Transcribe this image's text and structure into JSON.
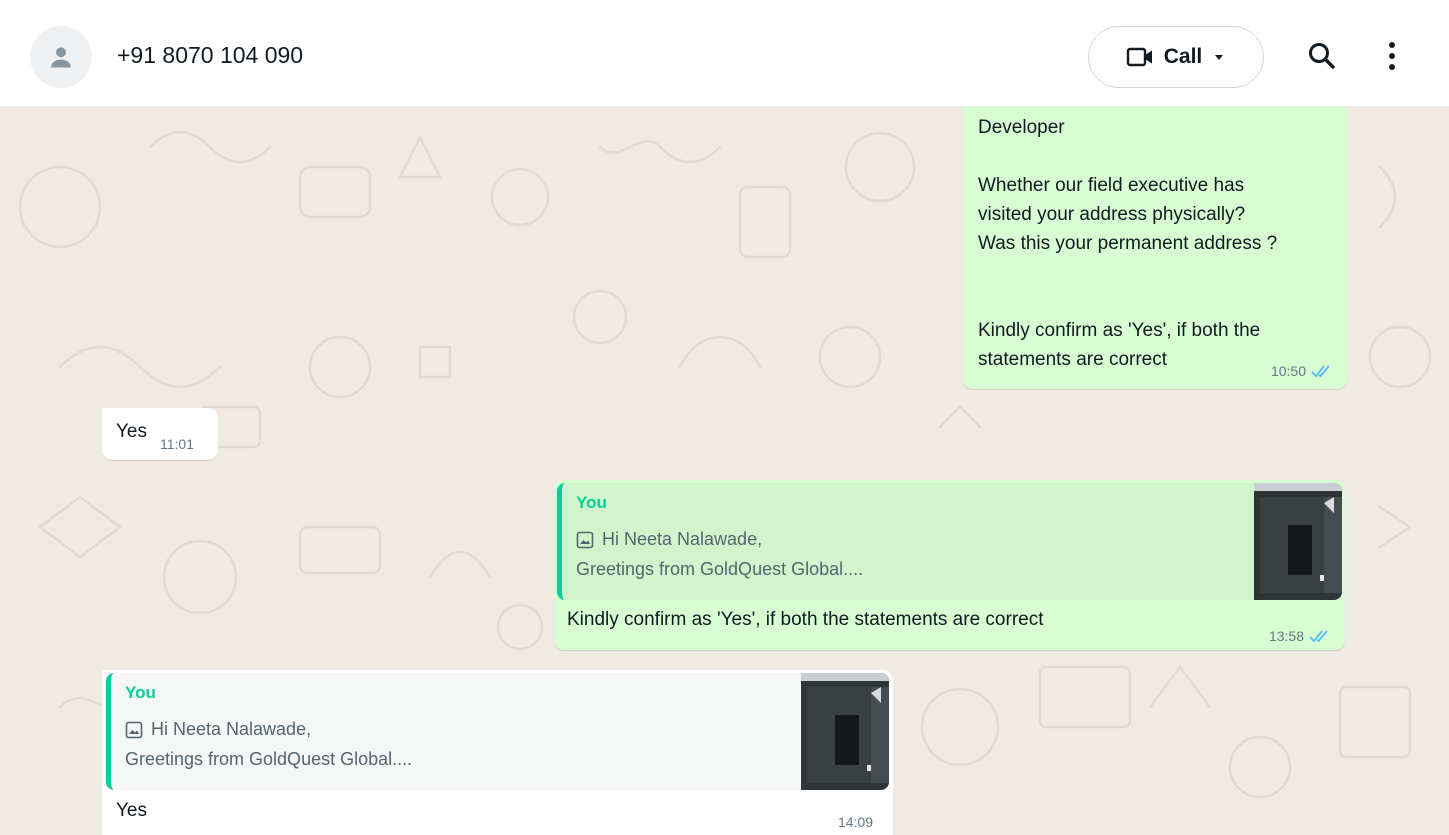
{
  "header": {
    "contact_name": "+91 8070 104 090",
    "call_label": "Call"
  },
  "messages": [
    {
      "direction": "outgoing",
      "text": "Developer\n\nWhether our field executive has\nvisited your address physically?\nWas this your permanent address ?\n\n\nKindly confirm as 'Yes', if both the\nstatements are correct",
      "time": "10:50",
      "status": "read"
    },
    {
      "direction": "incoming",
      "text": "Yes",
      "time": "11:01"
    },
    {
      "direction": "outgoing",
      "quote": {
        "author": "You",
        "line1": "Hi Neeta Nalawade,",
        "line2": "Greetings from GoldQuest Global...."
      },
      "text": "Kindly confirm as 'Yes', if both the statements are correct",
      "time": "13:58",
      "status": "read"
    },
    {
      "direction": "incoming",
      "quote": {
        "author": "You",
        "line1": "Hi Neeta Nalawade,",
        "line2": "Greetings from GoldQuest Global...."
      },
      "text": "Yes",
      "time": "14:09"
    }
  ],
  "colors": {
    "outgoing_bubble": "#d9fdd3",
    "incoming_bubble": "#ffffff",
    "chat_background": "#efeae2",
    "quote_accent": "#06cf9c",
    "read_ticks": "#53bdeb"
  },
  "icons": [
    "person-icon",
    "video-camera-icon",
    "caret-down-icon",
    "search-icon",
    "more-vertical-icon",
    "image-icon",
    "double-check-icon"
  ]
}
